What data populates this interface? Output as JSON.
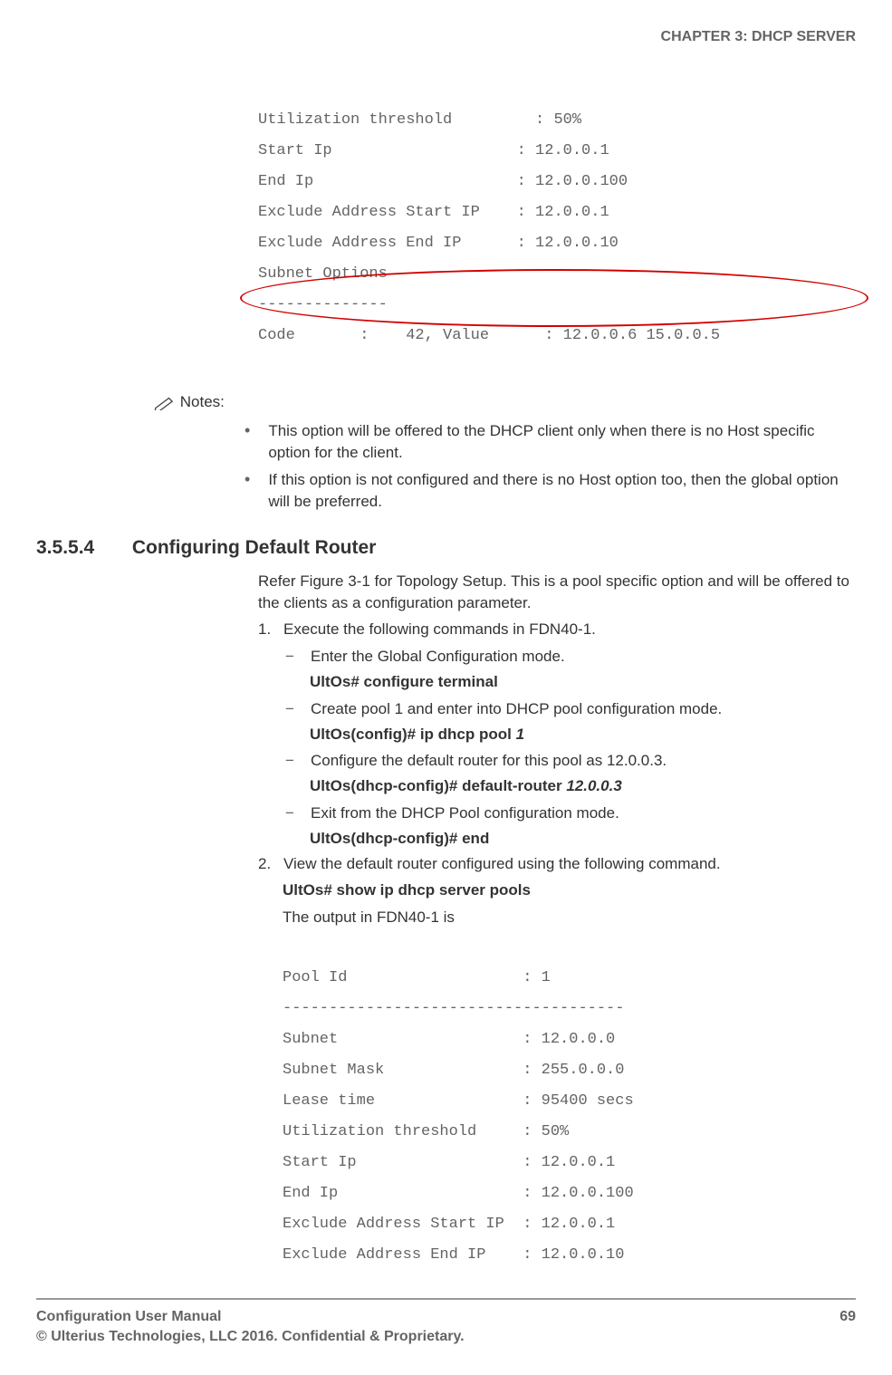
{
  "header": {
    "chapter": "CHAPTER 3: DHCP SERVER"
  },
  "code1": {
    "l1": "Utilization threshold         : 50%",
    "l2": "Start Ip                    : 12.0.0.1",
    "l3": "End Ip                      : 12.0.0.100",
    "l4": "Exclude Address Start IP    : 12.0.0.1",
    "l5": "Exclude Address End IP      : 12.0.0.10",
    "l6": "Subnet Options",
    "l7": "--------------",
    "l8": "Code       :    42, Value      : 12.0.0.6 15.0.0.5"
  },
  "notes": {
    "label": "Notes:",
    "b1": "This option will be offered to the DHCP client only when there is no Host specific option for the client.",
    "b2": "If this option is not configured and there is no Host option too, then the global option will be preferred."
  },
  "section": {
    "num": "3.5.5.4",
    "title": "Configuring Default Router",
    "intro": "Refer Figure 3-1 for Topology Setup. This is a pool specific option and will be offered to the clients as a configuration parameter.",
    "step1": {
      "marker": "1.",
      "text": "Execute the following commands in FDN40-1."
    },
    "sub1": {
      "dash": "−",
      "text": "Enter the Global Configuration mode.",
      "cmd": "UltOs# configure terminal"
    },
    "sub2": {
      "dash": "−",
      "text": "Create pool 1 and enter into DHCP pool configuration mode.",
      "cmd_pre": "UltOs(config)# ip dhcp pool ",
      "cmd_it": "1"
    },
    "sub3": {
      "dash": "−",
      "text": "Configure the default router for this pool as 12.0.0.3.",
      "cmd_pre": "UltOs(dhcp-config)# default-router ",
      "cmd_it": "12.0.0.3"
    },
    "sub4": {
      "dash": "−",
      "text": "Exit from the DHCP Pool configuration mode.",
      "cmd": "UltOs(dhcp-config)# end"
    },
    "step2": {
      "marker": "2.",
      "text": "View the default router configured using the following command."
    },
    "cmd2": "UltOs# show ip dhcp server pools",
    "output_label": "The output in FDN40-1 is"
  },
  "code2": {
    "l1": "Pool Id                   : 1",
    "l2": "-------------------------------------",
    "l3": "Subnet                    : 12.0.0.0",
    "l4": "Subnet Mask               : 255.0.0.0",
    "l5": "Lease time                : 95400 secs",
    "l6": "Utilization threshold     : 50%",
    "l7": "Start Ip                  : 12.0.0.1",
    "l8": "End Ip                    : 12.0.0.100",
    "l9": "Exclude Address Start IP  : 12.0.0.1",
    "l10": "Exclude Address End IP    : 12.0.0.10"
  },
  "footer": {
    "left1": "Configuration User Manual",
    "left2": "© Ulterius Technologies, LLC 2016. Confidential & Proprietary.",
    "page": "69"
  }
}
